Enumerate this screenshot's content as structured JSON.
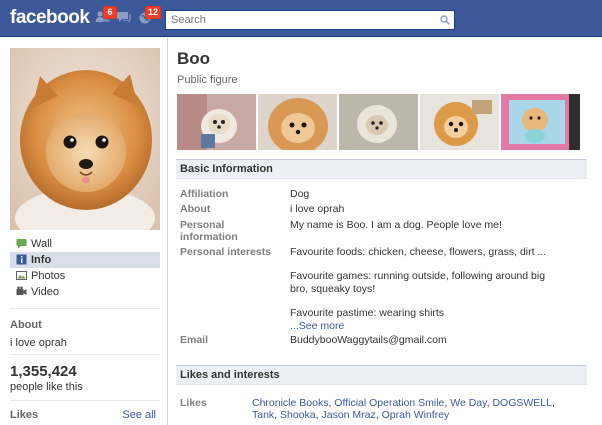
{
  "topbar": {
    "logo": "facebook",
    "friend_requests_count": "6",
    "notifications_count": "12",
    "search_placeholder": "Search"
  },
  "sidebar": {
    "nav": [
      {
        "label": "Wall",
        "icon": "wall-icon"
      },
      {
        "label": "Info",
        "icon": "info-icon",
        "active": true
      },
      {
        "label": "Photos",
        "icon": "photos-icon"
      },
      {
        "label": "Video",
        "icon": "video-icon"
      }
    ],
    "about_title": "About",
    "about_text": "i love oprah",
    "fans_count": "1,355,424",
    "fans_text": "people like this",
    "likes_title": "Likes",
    "see_all": "See all"
  },
  "page": {
    "name": "Boo",
    "category": "Public figure"
  },
  "basic_info": {
    "title": "Basic Information",
    "rows": [
      {
        "label": "Affiliation",
        "value": "Dog"
      },
      {
        "label": "About",
        "value": "i love oprah"
      },
      {
        "label": "Personal information",
        "value": "My name is Boo. I am a dog. People love me!"
      },
      {
        "label": "Personal interests",
        "value_1": "Favourite foods: chicken, cheese, flowers, grass, dirt ...",
        "value_2": "Favourite games: running outside, following around big bro, squeaky toys!",
        "value_3": "Favourite pastime: wearing shirts",
        "see_more": "...See more"
      },
      {
        "label": "Email",
        "value": "BuddybooWaggytails@gmail.com"
      }
    ]
  },
  "likes_interests": {
    "title": "Likes and interests",
    "label": "Likes",
    "items": [
      "Chronicle Books",
      "Official Operation Smile",
      "We Day",
      "DOGSWELL",
      "Tank",
      "Shooka",
      "Jason Mraz",
      "Oprah Winfrey"
    ]
  },
  "colors": {
    "brand_blue": "#3b5998",
    "badge_red": "#f03d25",
    "header_bg": "#eceff5",
    "active_nav": "#d8dfea"
  }
}
